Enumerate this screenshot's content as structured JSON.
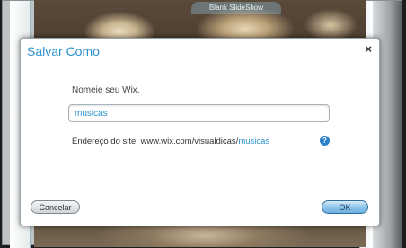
{
  "background": {
    "slideshow_caption": "Blank SlideShow"
  },
  "dialog": {
    "title": "Salvar Como",
    "close_glyph": "×",
    "prompt_label": "Nomeie seu Wix.",
    "name_input": {
      "value": "musicas",
      "placeholder": ""
    },
    "site_address": {
      "prefix": "Endereço do site: www.wix.com/visualdicas/",
      "slug": "musicas"
    },
    "help_glyph": "?",
    "cancel_label": "Cancelar",
    "ok_label": "OK"
  },
  "colors": {
    "accent": "#2a93d0",
    "help_icon": "#2a7fc9"
  }
}
